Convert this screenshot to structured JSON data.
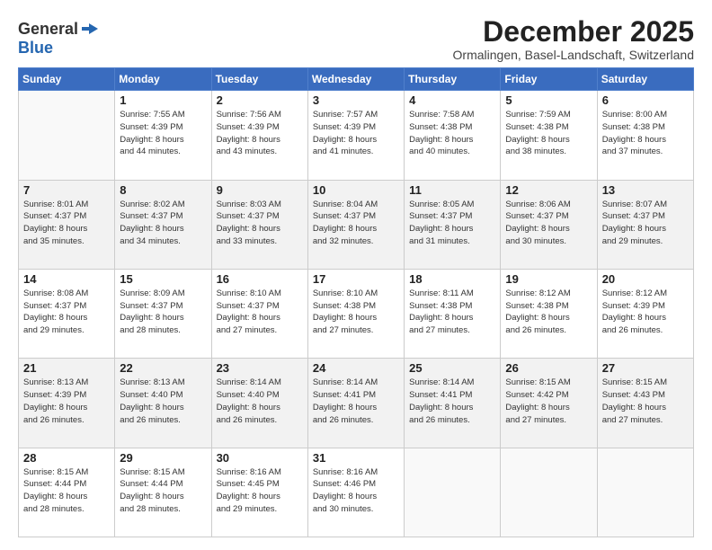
{
  "header": {
    "logo_general": "General",
    "logo_blue": "Blue",
    "month_title": "December 2025",
    "location": "Ormalingen, Basel-Landschaft, Switzerland"
  },
  "weekdays": [
    "Sunday",
    "Monday",
    "Tuesday",
    "Wednesday",
    "Thursday",
    "Friday",
    "Saturday"
  ],
  "weeks": [
    [
      {
        "day": "",
        "info": ""
      },
      {
        "day": "1",
        "info": "Sunrise: 7:55 AM\nSunset: 4:39 PM\nDaylight: 8 hours\nand 44 minutes."
      },
      {
        "day": "2",
        "info": "Sunrise: 7:56 AM\nSunset: 4:39 PM\nDaylight: 8 hours\nand 43 minutes."
      },
      {
        "day": "3",
        "info": "Sunrise: 7:57 AM\nSunset: 4:39 PM\nDaylight: 8 hours\nand 41 minutes."
      },
      {
        "day": "4",
        "info": "Sunrise: 7:58 AM\nSunset: 4:38 PM\nDaylight: 8 hours\nand 40 minutes."
      },
      {
        "day": "5",
        "info": "Sunrise: 7:59 AM\nSunset: 4:38 PM\nDaylight: 8 hours\nand 38 minutes."
      },
      {
        "day": "6",
        "info": "Sunrise: 8:00 AM\nSunset: 4:38 PM\nDaylight: 8 hours\nand 37 minutes."
      }
    ],
    [
      {
        "day": "7",
        "info": "Sunrise: 8:01 AM\nSunset: 4:37 PM\nDaylight: 8 hours\nand 35 minutes."
      },
      {
        "day": "8",
        "info": "Sunrise: 8:02 AM\nSunset: 4:37 PM\nDaylight: 8 hours\nand 34 minutes."
      },
      {
        "day": "9",
        "info": "Sunrise: 8:03 AM\nSunset: 4:37 PM\nDaylight: 8 hours\nand 33 minutes."
      },
      {
        "day": "10",
        "info": "Sunrise: 8:04 AM\nSunset: 4:37 PM\nDaylight: 8 hours\nand 32 minutes."
      },
      {
        "day": "11",
        "info": "Sunrise: 8:05 AM\nSunset: 4:37 PM\nDaylight: 8 hours\nand 31 minutes."
      },
      {
        "day": "12",
        "info": "Sunrise: 8:06 AM\nSunset: 4:37 PM\nDaylight: 8 hours\nand 30 minutes."
      },
      {
        "day": "13",
        "info": "Sunrise: 8:07 AM\nSunset: 4:37 PM\nDaylight: 8 hours\nand 29 minutes."
      }
    ],
    [
      {
        "day": "14",
        "info": "Sunrise: 8:08 AM\nSunset: 4:37 PM\nDaylight: 8 hours\nand 29 minutes."
      },
      {
        "day": "15",
        "info": "Sunrise: 8:09 AM\nSunset: 4:37 PM\nDaylight: 8 hours\nand 28 minutes."
      },
      {
        "day": "16",
        "info": "Sunrise: 8:10 AM\nSunset: 4:37 PM\nDaylight: 8 hours\nand 27 minutes."
      },
      {
        "day": "17",
        "info": "Sunrise: 8:10 AM\nSunset: 4:38 PM\nDaylight: 8 hours\nand 27 minutes."
      },
      {
        "day": "18",
        "info": "Sunrise: 8:11 AM\nSunset: 4:38 PM\nDaylight: 8 hours\nand 27 minutes."
      },
      {
        "day": "19",
        "info": "Sunrise: 8:12 AM\nSunset: 4:38 PM\nDaylight: 8 hours\nand 26 minutes."
      },
      {
        "day": "20",
        "info": "Sunrise: 8:12 AM\nSunset: 4:39 PM\nDaylight: 8 hours\nand 26 minutes."
      }
    ],
    [
      {
        "day": "21",
        "info": "Sunrise: 8:13 AM\nSunset: 4:39 PM\nDaylight: 8 hours\nand 26 minutes."
      },
      {
        "day": "22",
        "info": "Sunrise: 8:13 AM\nSunset: 4:40 PM\nDaylight: 8 hours\nand 26 minutes."
      },
      {
        "day": "23",
        "info": "Sunrise: 8:14 AM\nSunset: 4:40 PM\nDaylight: 8 hours\nand 26 minutes."
      },
      {
        "day": "24",
        "info": "Sunrise: 8:14 AM\nSunset: 4:41 PM\nDaylight: 8 hours\nand 26 minutes."
      },
      {
        "day": "25",
        "info": "Sunrise: 8:14 AM\nSunset: 4:41 PM\nDaylight: 8 hours\nand 26 minutes."
      },
      {
        "day": "26",
        "info": "Sunrise: 8:15 AM\nSunset: 4:42 PM\nDaylight: 8 hours\nand 27 minutes."
      },
      {
        "day": "27",
        "info": "Sunrise: 8:15 AM\nSunset: 4:43 PM\nDaylight: 8 hours\nand 27 minutes."
      }
    ],
    [
      {
        "day": "28",
        "info": "Sunrise: 8:15 AM\nSunset: 4:44 PM\nDaylight: 8 hours\nand 28 minutes."
      },
      {
        "day": "29",
        "info": "Sunrise: 8:15 AM\nSunset: 4:44 PM\nDaylight: 8 hours\nand 28 minutes."
      },
      {
        "day": "30",
        "info": "Sunrise: 8:16 AM\nSunset: 4:45 PM\nDaylight: 8 hours\nand 29 minutes."
      },
      {
        "day": "31",
        "info": "Sunrise: 8:16 AM\nSunset: 4:46 PM\nDaylight: 8 hours\nand 30 minutes."
      },
      {
        "day": "",
        "info": ""
      },
      {
        "day": "",
        "info": ""
      },
      {
        "day": "",
        "info": ""
      }
    ]
  ]
}
